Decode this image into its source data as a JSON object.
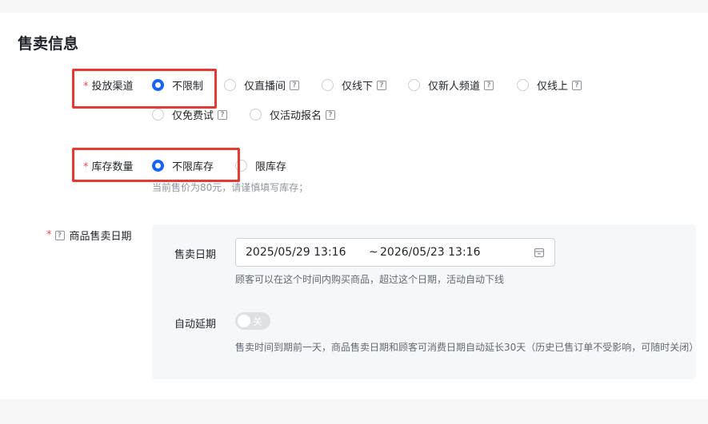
{
  "section": {
    "title": "售卖信息"
  },
  "channel": {
    "label": "投放渠道",
    "options": [
      {
        "label": "不限制",
        "checked": true,
        "help": false
      },
      {
        "label": "仅直播间",
        "checked": false,
        "help": true
      },
      {
        "label": "仅线下",
        "checked": false,
        "help": true
      },
      {
        "label": "仅新人频道",
        "checked": false,
        "help": true
      },
      {
        "label": "仅线上",
        "checked": false,
        "help": true
      },
      {
        "label": "仅免费试",
        "checked": false,
        "help": true
      },
      {
        "label": "仅活动报名",
        "checked": false,
        "help": true
      }
    ]
  },
  "stock": {
    "label": "库存数量",
    "options": [
      {
        "label": "不限库存",
        "checked": true
      },
      {
        "label": "限库存",
        "checked": false
      }
    ],
    "hint": "当前售价为80元，请谨慎填写库存；"
  },
  "sale_period": {
    "label": "商品售卖日期",
    "date_label": "售卖日期",
    "start": "2025/05/29 13:16",
    "separator": "~",
    "end": "2026/05/23 13:16",
    "date_hint": "顾客可以在这个时间内购买商品，超过这个日期，活动自动下线",
    "auto_extend_label": "自动延期",
    "switch_text": "关",
    "auto_extend_desc": "售卖时间到期前一天，商品售卖日期和顾客可消费日期自动延长30天（历史已售订单不受影响，可随时关闭）"
  },
  "colors": {
    "accent": "#1664ff",
    "required": "#f54a45",
    "highlight_box": "#e53935"
  },
  "required_mark": "*",
  "help_glyph": "?"
}
